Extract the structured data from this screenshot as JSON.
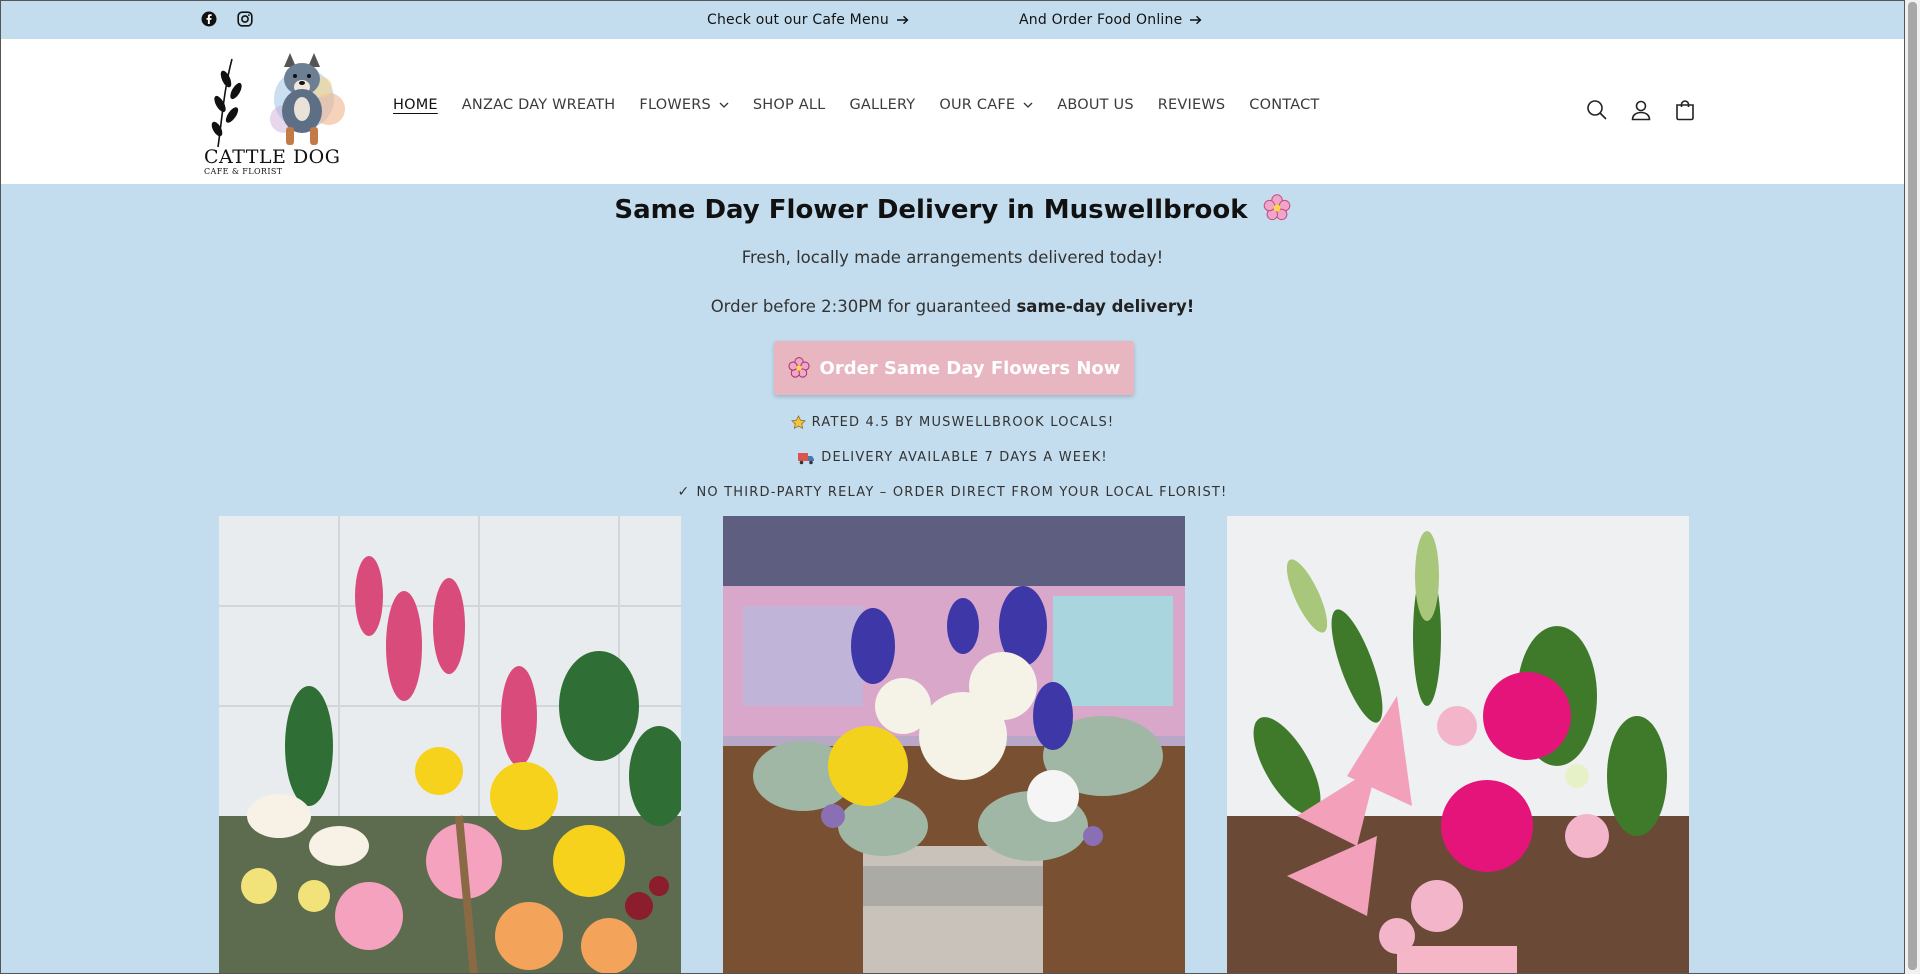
{
  "announcement": {
    "left_link": "Check out our Cafe Menu",
    "right_link": "And Order Food Online"
  },
  "social": [
    "facebook-icon",
    "instagram-icon"
  ],
  "logo": {
    "line1": "CATTLE DOG",
    "line2": "CAFE & FLORIST"
  },
  "nav": {
    "items": [
      {
        "label": "HOME",
        "active": true,
        "dropdown": false
      },
      {
        "label": "ANZAC DAY WREATH",
        "active": false,
        "dropdown": false
      },
      {
        "label": "FLOWERS",
        "active": false,
        "dropdown": true
      },
      {
        "label": "SHOP ALL",
        "active": false,
        "dropdown": false
      },
      {
        "label": "GALLERY",
        "active": false,
        "dropdown": false
      },
      {
        "label": "OUR CAFE",
        "active": false,
        "dropdown": true
      },
      {
        "label": "ABOUT US",
        "active": false,
        "dropdown": false
      },
      {
        "label": "REVIEWS",
        "active": false,
        "dropdown": false
      },
      {
        "label": "CONTACT",
        "active": false,
        "dropdown": false
      }
    ]
  },
  "header_icons": [
    "search-icon",
    "account-icon",
    "cart-icon"
  ],
  "hero": {
    "title": "Same Day Flower Delivery in Muswellbrook",
    "subtitle": "Fresh, locally made arrangements delivered today!",
    "order_prefix": "Order before 2:30PM for guaranteed ",
    "order_bold": "same-day delivery!",
    "cta_label": "Order Same Day Flowers Now",
    "badges": [
      "RATED 4.5 BY MUSWELLBROOK LOCALS!",
      "DELIVERY AVAILABLE 7 DAYS A WEEK!",
      "NO THIRD-PARTY RELAY – ORDER DIRECT FROM YOUR LOCAL FLORIST!"
    ]
  },
  "colors": {
    "background": "#c3ddee",
    "header": "#ffffff",
    "cta": "#e7b6c1"
  }
}
